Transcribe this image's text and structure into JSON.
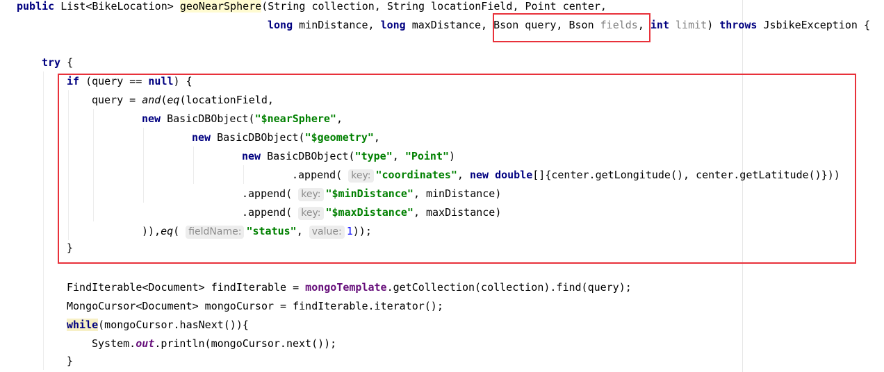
{
  "colors": {
    "keyword": "#000080",
    "string": "#008000",
    "field": "#660e7a",
    "unused_param": "#808080",
    "number": "#0000ff",
    "highlight_box": "#e8313a",
    "inlay_hint_bg": "#ededed"
  },
  "code": {
    "l1": {
      "public": "public",
      "ret_type": " List<BikeLocation> ",
      "method": "geoNearSphere",
      "params": "(String collection, String locationField, Point center,"
    },
    "l2": {
      "long1": "long",
      "p1": " minDistance, ",
      "long2": "long",
      "p2": " maxDistance, ",
      "bson_q": "Bson query, Bson ",
      "fields": "fields",
      "comma": ",",
      "int_kw": "int",
      "limit": " limit",
      "paren": ") ",
      "throws": "throws",
      "exc": " JsbikeException {"
    },
    "l3": {
      "try": "try",
      "rest": " {"
    },
    "l4": {
      "if": "if",
      "mid": " (query == ",
      "null": "null",
      "rest": ") {"
    },
    "l5": {
      "a": "query = ",
      "and": "and",
      "b": "(",
      "eq": "eq",
      "c": "(locationField,"
    },
    "l6": {
      "new": "new",
      "a": " BasicDBObject(",
      "s": "\"$nearSphere\"",
      "b": ","
    },
    "l7": {
      "new": "new",
      "a": " BasicDBObject(",
      "s": "\"$geometry\"",
      "b": ","
    },
    "l8": {
      "new": "new",
      "a": " BasicDBObject(",
      "s1": "\"type\"",
      "b": ", ",
      "s2": "\"Point\"",
      "c": ")"
    },
    "l9": {
      "a": ".append( ",
      "hint": "key:",
      "s": "\"coordinates\"",
      "b": ", ",
      "new": "new",
      "c": " ",
      "double": "double",
      "d": "[]{center.getLongitude(), center.getLatitude()}))"
    },
    "l10": {
      "a": ".append( ",
      "hint": "key:",
      "s": "\"$minDistance\"",
      "b": ", minDistance)"
    },
    "l11": {
      "a": ".append( ",
      "hint": "key:",
      "s": "\"$maxDistance\"",
      "b": ", maxDistance)"
    },
    "l12": {
      "a": ")),",
      "eq": "eq",
      "b": "( ",
      "hint1": "fieldName:",
      "s": "\"status\"",
      "c": ", ",
      "hint2": "value:",
      "num": "1",
      "d": "));"
    },
    "l13": {
      "brace": "}"
    },
    "l14": {
      "a": "FindIterable<Document> findIterable = ",
      "field": "mongoTemplate",
      "b": ".getCollection(collection).find(query);"
    },
    "l15": {
      "a": "MongoCursor<Document> mongoCursor = findIterable.iterator();"
    },
    "l16": {
      "while": "while",
      "a": "(mongoCursor.hasNext()){"
    },
    "l17": {
      "a": "System.",
      "out": "out",
      "b": ".println(mongoCursor.next());"
    },
    "l18": {
      "brace": "}"
    }
  }
}
